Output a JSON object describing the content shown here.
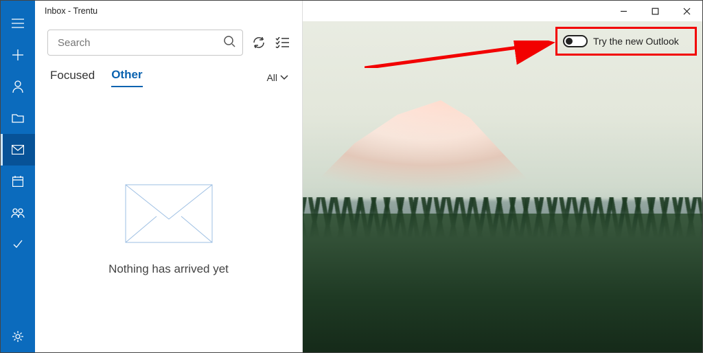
{
  "window": {
    "title": "Inbox - Trentu"
  },
  "search": {
    "placeholder": "Search"
  },
  "tabs": {
    "focused": "Focused",
    "other": "Other",
    "filter_label": "All"
  },
  "empty": {
    "message": "Nothing has arrived yet"
  },
  "callout": {
    "toggle_label": "Try the new Outlook"
  },
  "nav": {
    "menu": "menu",
    "new": "new-mail",
    "accounts": "accounts",
    "folders": "folders",
    "mail": "mail",
    "calendar": "calendar",
    "people": "people",
    "todo": "todo",
    "settings": "settings"
  }
}
